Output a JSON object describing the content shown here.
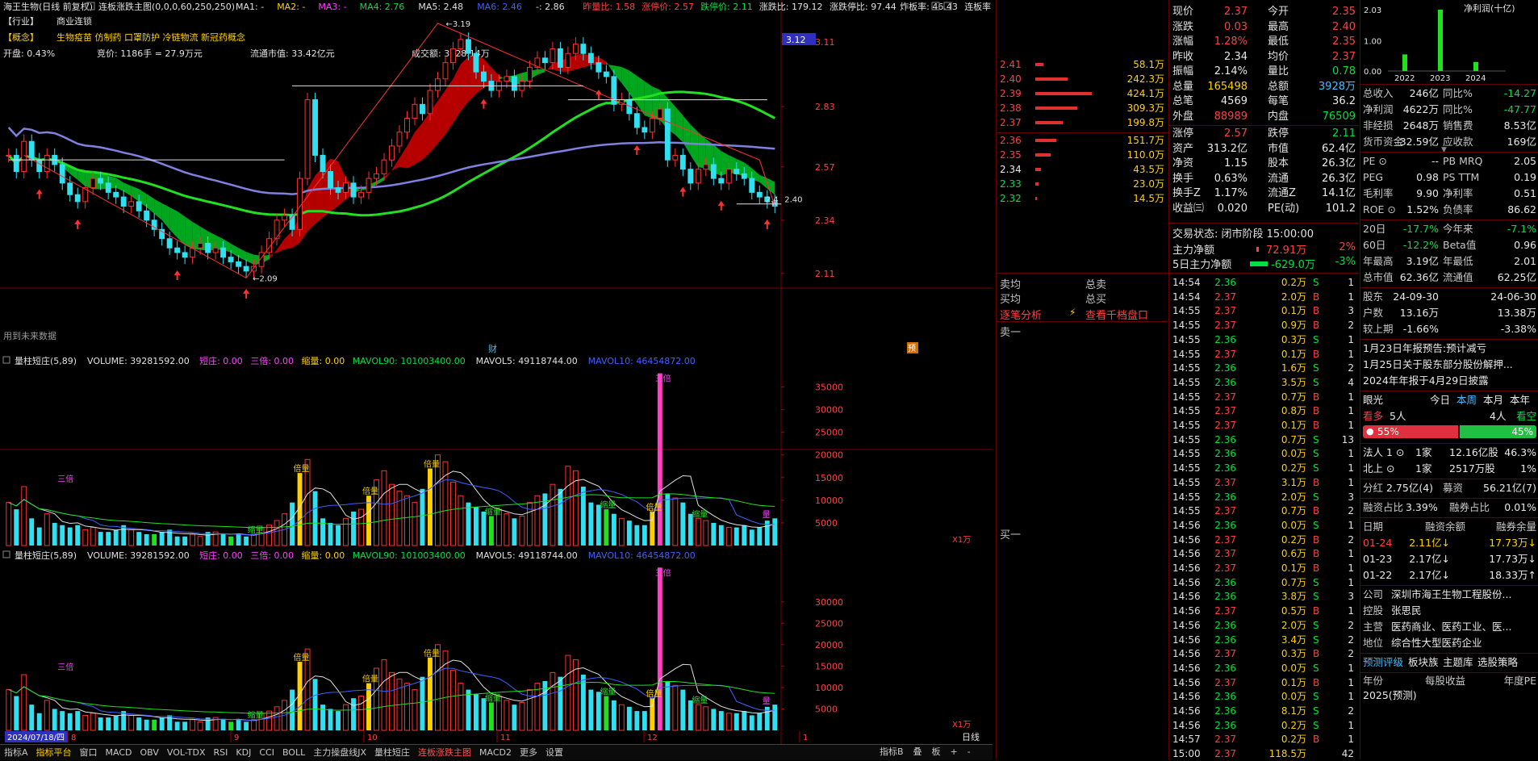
{
  "chart": {
    "title": "海王生物(日线 前复权)",
    "indicator_main": "连板涨跌主图(0,0,0,60,250,250)",
    "ma_labels": [
      {
        "text": "MA1: -",
        "color": "#e0e0e0"
      },
      {
        "text": "MA2: -",
        "color": "#ffd000"
      },
      {
        "text": "MA3: -",
        "color": "#ff40ff"
      },
      {
        "text": "MA4: 2.76",
        "color": "#00e040"
      },
      {
        "text": "MA5: 2.48",
        "color": "#e0e0e0"
      },
      {
        "text": "MA6: 2.46",
        "color": "#4060ff"
      },
      {
        "text": "-: 2.86",
        "color": "#e0e0e0"
      },
      {
        "text": "昨量比: 1.58",
        "color": "#ff4040"
      },
      {
        "text": "涨停价: 2.57",
        "color": "#ff4040"
      },
      {
        "text": "跌停价: 2.11",
        "color": "#00e040"
      },
      {
        "text": "涨跌比: 179.12",
        "color": "#e0e0e0"
      },
      {
        "text": "涨跌停比: 97.44",
        "color": "#e0e0e0"
      },
      {
        "text": "炸板率: 46.43",
        "color": "#e0e0e0"
      },
      {
        "text": "连板率",
        "color": "#e0e0e0"
      }
    ],
    "industry_label": "【行业】",
    "industry_value": "商业连锁",
    "concept_label": "【概念】",
    "concept_value": "生物疫苗 仿制药 口罩防护 冷链物流 新冠药概念",
    "open_pct": "开盘: 0.43%",
    "auction": "竞价: 1186手 = 27.9万元",
    "float_cap": "流通市值: 33.42亿元",
    "turnover_amt": "成交额: 3928.14万",
    "future_data_note": "用到未来数据",
    "price_axis": [
      "3.11",
      "2.83",
      "2.57",
      "2.34",
      "2.11"
    ],
    "current_price_tag": "3.12",
    "high_label": "3.19",
    "low_label": "2.09",
    "last_label": "2.4",
    "last_label_right": "2.40",
    "fin_marker": "财",
    "pre_marker": "预",
    "vol_title": "量柱短庄(5,89)",
    "vol_items": [
      {
        "text": "VOLUME: 39281592.00",
        "color": "#e0e0e0"
      },
      {
        "text": "短庄: 0.00",
        "color": "#ff40ff"
      },
      {
        "text": "三倍: 0.00",
        "color": "#ff40ff"
      },
      {
        "text": "缩量: 0.00",
        "color": "#ffd000"
      },
      {
        "text": "MAVOL90: 101003400.00",
        "color": "#00e040"
      },
      {
        "text": "MAVOL5: 49118744.00",
        "color": "#e0e0e0"
      },
      {
        "text": "MAVOL10: 46454872.00",
        "color": "#4060ff"
      }
    ],
    "vol_axis_1": [
      "35000",
      "30000",
      "25000",
      "20000",
      "15000",
      "10000",
      "5000"
    ],
    "vol_axis_2": [
      "30000",
      "25000",
      "20000",
      "15000",
      "10000",
      "5000"
    ],
    "vol_unit": "X1万",
    "vol_tag_beiliang": "倍量",
    "vol_tag_suoliang": "缩量",
    "vol_tag_sanbei": "三倍",
    "vol_tag_duanzhuang": "三倍",
    "date_label": "2024/07/18/四",
    "month_labels": [
      "8",
      "9",
      "10",
      "11",
      "12",
      "1"
    ],
    "period": "日线"
  },
  "chart_data": {
    "type": "candlestick",
    "ylim": [
      2.05,
      3.2
    ],
    "closes": [
      2.62,
      2.55,
      2.68,
      2.6,
      2.55,
      2.62,
      2.58,
      2.5,
      2.45,
      2.42,
      2.48,
      2.52,
      2.5,
      2.46,
      2.44,
      2.4,
      2.42,
      2.38,
      2.34,
      2.3,
      2.26,
      2.22,
      2.2,
      2.18,
      2.22,
      2.24,
      2.2,
      2.22,
      2.18,
      2.16,
      2.14,
      2.12,
      2.14,
      2.2,
      2.26,
      2.34,
      2.36,
      2.3,
      2.52,
      2.86,
      2.62,
      2.55,
      2.48,
      2.46,
      2.5,
      2.44,
      2.46,
      2.52,
      2.54,
      2.6,
      2.66,
      2.72,
      2.78,
      2.84,
      2.8,
      2.9,
      2.95,
      3.02,
      3.08,
      3.12,
      3.06,
      2.98,
      2.94,
      2.9,
      2.94,
      2.96,
      2.9,
      2.94,
      3.0,
      3.04,
      3.02,
      3.08,
      3.0,
      3.06,
      3.1,
      3.06,
      3.02,
      2.98,
      2.96,
      2.84,
      2.86,
      2.8,
      2.74,
      2.72,
      2.78,
      2.82,
      2.6,
      2.62,
      2.56,
      2.5,
      2.56,
      2.58,
      2.52,
      2.5,
      2.56,
      2.54,
      2.52,
      2.46,
      2.44,
      2.42,
      2.4
    ],
    "volumes": [
      95,
      80,
      130,
      60,
      40,
      70,
      50,
      45,
      40,
      45,
      35,
      40,
      30,
      30,
      35,
      45,
      35,
      30,
      25,
      25,
      30,
      35,
      20,
      20,
      25,
      20,
      30,
      30,
      25,
      20,
      25,
      20,
      25,
      40,
      45,
      55,
      70,
      95,
      160,
      190,
      120,
      60,
      50,
      45,
      60,
      75,
      80,
      110,
      145,
      165,
      135,
      120,
      110,
      95,
      125,
      170,
      200,
      185,
      140,
      110,
      95,
      85,
      75,
      65,
      80,
      70,
      60,
      65,
      95,
      110,
      115,
      135,
      125,
      175,
      165,
      130,
      95,
      90,
      80,
      70,
      60,
      55,
      45,
      45,
      75,
      380,
      115,
      105,
      95,
      70,
      60,
      55,
      50,
      45,
      40,
      40,
      45,
      35,
      40,
      55,
      60
    ],
    "volume_unit": "万手"
  },
  "order_book": {
    "asks": [
      {
        "price": "2.41",
        "vol": "58.1万",
        "bar": 10
      },
      {
        "price": "2.40",
        "vol": "242.3万",
        "bar": 40
      },
      {
        "price": "2.39",
        "vol": "424.1万",
        "bar": 70
      },
      {
        "price": "2.38",
        "vol": "309.3万",
        "bar": 52
      },
      {
        "price": "2.37",
        "vol": "199.8万",
        "bar": 34
      }
    ],
    "bids": [
      {
        "price": "2.36",
        "vol": "151.7万",
        "bar": 26
      },
      {
        "price": "2.35",
        "vol": "110.0万",
        "bar": 19
      },
      {
        "price": "2.34",
        "vol": "43.5万",
        "bar": 7
      },
      {
        "price": "2.33",
        "vol": "23.0万",
        "bar": 4
      },
      {
        "price": "2.32",
        "vol": "14.5万",
        "bar": 2
      }
    ],
    "sell_avg": "卖均",
    "buy_avg": "买均",
    "total_sell": "总卖",
    "total_buy": "总买",
    "tick_analysis": "逐笔分析",
    "view_depth": "查看千档盘口",
    "sell_one": "卖一",
    "buy_one": "买一"
  },
  "quote": {
    "rows": [
      {
        "l1": "现价",
        "v1": "2.37",
        "c1": "red",
        "l2": "今开",
        "v2": "2.35",
        "c2": "red"
      },
      {
        "l1": "涨跌",
        "v1": "0.03",
        "c1": "red",
        "l2": "最高",
        "v2": "2.40",
        "c2": "red"
      },
      {
        "l1": "涨幅",
        "v1": "1.28%",
        "c1": "red",
        "l2": "最低",
        "v2": "2.35",
        "c2": "red"
      },
      {
        "l1": "昨收",
        "v1": "2.34",
        "c1": "white",
        "l2": "均价",
        "v2": "2.37",
        "c2": "red"
      },
      {
        "l1": "振幅",
        "v1": "2.14%",
        "c1": "white",
        "l2": "量比",
        "v2": "0.78",
        "c2": "green"
      },
      {
        "l1": "总量",
        "v1": "165498",
        "c1": "yellow",
        "l2": "总额",
        "v2": "3928万",
        "c2": "cyan"
      },
      {
        "l1": "总笔",
        "v1": "4569",
        "c1": "white",
        "l2": "每笔",
        "v2": "36.2",
        "c2": "white"
      },
      {
        "l1": "外盘",
        "v1": "88989",
        "c1": "red",
        "l2": "内盘",
        "v2": "76509",
        "c2": "green"
      },
      {
        "l1": "涨停",
        "v1": "2.57",
        "c1": "red",
        "l2": "跌停",
        "v2": "2.11",
        "c2": "green"
      },
      {
        "l1": "资产",
        "v1": "313.2亿",
        "c1": "white",
        "l2": "市值",
        "v2": "62.4亿",
        "c2": "white"
      },
      {
        "l1": "净资",
        "v1": "1.15",
        "c1": "white",
        "l2": "股本",
        "v2": "26.3亿",
        "c2": "white"
      },
      {
        "l1": "换手",
        "v1": "0.63%",
        "c1": "white",
        "l2": "流通",
        "v2": "26.3亿",
        "c2": "white"
      },
      {
        "l1": "换手Z",
        "v1": "1.17%",
        "c1": "white",
        "l2": "流通Z",
        "v2": "14.1亿",
        "c2": "white"
      },
      {
        "l1": "收益㈢",
        "v1": "0.020",
        "c1": "white",
        "l2": "PE(动)",
        "v2": "101.2",
        "c2": "white"
      }
    ],
    "trade_status": "交易状态: 闭市阶段 15:00:00",
    "main_net_label": "主力净额",
    "main_net_val": "72.91万",
    "main_net_pct": "2%",
    "five_day_label": "5日主力净额",
    "five_day_val": "-629.0万",
    "five_day_pct": "-3%",
    "ticks": [
      [
        "14:54",
        "2.36",
        "0.2万",
        "S",
        "1"
      ],
      [
        "14:54",
        "2.37",
        "2.0万",
        "B",
        "1"
      ],
      [
        "14:55",
        "2.37",
        "0.1万",
        "B",
        "3"
      ],
      [
        "14:55",
        "2.37",
        "0.9万",
        "B",
        "2"
      ],
      [
        "14:55",
        "2.36",
        "0.3万",
        "S",
        "1"
      ],
      [
        "14:55",
        "2.37",
        "0.1万",
        "B",
        "1"
      ],
      [
        "14:55",
        "2.36",
        "1.6万",
        "S",
        "2"
      ],
      [
        "14:55",
        "2.36",
        "3.5万",
        "S",
        "4"
      ],
      [
        "14:55",
        "2.37",
        "0.7万",
        "B",
        "1"
      ],
      [
        "14:55",
        "2.37",
        "0.8万",
        "B",
        "1"
      ],
      [
        "14:55",
        "2.37",
        "0.1万",
        "B",
        "1"
      ],
      [
        "14:55",
        "2.36",
        "0.7万",
        "S",
        "13"
      ],
      [
        "14:55",
        "2.36",
        "0.0万",
        "S",
        "1"
      ],
      [
        "14:55",
        "2.36",
        "0.2万",
        "S",
        "1"
      ],
      [
        "14:55",
        "2.37",
        "3.1万",
        "B",
        "1"
      ],
      [
        "14:55",
        "2.36",
        "2.0万",
        "S",
        "3"
      ],
      [
        "14:55",
        "2.37",
        "0.7万",
        "B",
        "2"
      ],
      [
        "14:56",
        "2.36",
        "0.0万",
        "S",
        "1"
      ],
      [
        "14:56",
        "2.37",
        "0.2万",
        "B",
        "2"
      ],
      [
        "14:56",
        "2.37",
        "0.6万",
        "B",
        "1"
      ],
      [
        "14:56",
        "2.37",
        "0.1万",
        "B",
        "1"
      ],
      [
        "14:56",
        "2.36",
        "0.7万",
        "S",
        "1"
      ],
      [
        "14:56",
        "2.36",
        "3.8万",
        "S",
        "3"
      ],
      [
        "14:56",
        "2.37",
        "0.5万",
        "B",
        "1"
      ],
      [
        "14:56",
        "2.36",
        "2.0万",
        "S",
        "2"
      ],
      [
        "14:56",
        "2.36",
        "3.4万",
        "S",
        "2"
      ],
      [
        "14:56",
        "2.37",
        "0.3万",
        "B",
        "2"
      ],
      [
        "14:56",
        "2.36",
        "0.0万",
        "S",
        "1"
      ],
      [
        "14:56",
        "2.37",
        "0.1万",
        "B",
        "1"
      ],
      [
        "14:56",
        "2.36",
        "0.0万",
        "S",
        "1"
      ],
      [
        "14:56",
        "2.36",
        "8.1万",
        "S",
        "2"
      ],
      [
        "14:56",
        "2.36",
        "0.2万",
        "S",
        "1"
      ],
      [
        "14:57",
        "2.37",
        "0.2万",
        "B",
        "1"
      ],
      [
        "15:00",
        "2.37",
        "118.5万",
        "",
        "42"
      ]
    ]
  },
  "f10": {
    "profit_axis": [
      "2.03",
      "1.00",
      "0.00"
    ],
    "profit_title": "净利润(十亿)",
    "profit_years": [
      "2022",
      "2023",
      "2024"
    ],
    "profit_values": [
      0.55,
      2.03,
      0.3
    ],
    "rows": [
      {
        "l1": "总收入",
        "v1": "246亿",
        "l2": "同比%",
        "v2": "-14.27",
        "c2": "green"
      },
      {
        "l1": "净利润",
        "v1": "4622万",
        "l2": "同比%",
        "v2": "-47.77",
        "c2": "green"
      },
      {
        "l1": "非经损",
        "v1": "2648万",
        "l2": "销售费",
        "v2": "8.53亿",
        "c2": "white"
      },
      {
        "l1": "货币资金",
        "v1": "32.59亿",
        "l2": "应收款",
        "v2": "169亿",
        "c2": "white"
      }
    ],
    "rows2": [
      {
        "l1": "PE ⊙",
        "v1": "--",
        "l2": "PB MRQ",
        "v2": "2.05"
      },
      {
        "l1": "PEG",
        "v1": "0.98",
        "l2": "PS TTM",
        "v2": "0.19"
      },
      {
        "l1": "毛利率",
        "v1": "9.90",
        "l2": "净利率",
        "v2": "0.51"
      },
      {
        "l1": "ROE ⊙",
        "v1": "1.52%",
        "l2": "负债率",
        "v2": "86.62"
      }
    ],
    "rows3": [
      {
        "l1": "20日",
        "v1": "-17.7%",
        "c1": "green",
        "l2": "今年来",
        "v2": "-7.1%",
        "c2": "green"
      },
      {
        "l1": "60日",
        "v1": "-12.2%",
        "c1": "green",
        "l2": "Beta值",
        "v2": "0.96",
        "c2": "white"
      },
      {
        "l1": "年最高",
        "v1": "3.19亿",
        "c1": "white",
        "l2": "年最低",
        "v2": "2.01",
        "c2": "white"
      },
      {
        "l1": "总市值",
        "v1": "62.36亿",
        "c1": "white",
        "l2": "流通值",
        "v2": "62.25亿",
        "c2": "white"
      }
    ],
    "holders_label": "股东",
    "holders_d1": "24-09-30",
    "holders_d2": "24-06-30",
    "households_label": "户数",
    "households_v1": "13.16万",
    "households_v2": "13.38万",
    "vs_prev_label": "较上期",
    "vs_prev_v1": "-1.66%",
    "vs_prev_v2": "-3.38%",
    "news": [
      "1月23日年报预告:预计减亏",
      "1月25日关于股东部分股份解押...",
      "2024年年报于4月29日披露"
    ],
    "eye_label": "眼光",
    "eye_tabs": [
      "今日",
      "本周",
      "本月",
      "本年"
    ],
    "bull_label": "看多",
    "bull_count": "5人",
    "bear_count": "4人",
    "bear_label": "看空",
    "bull_pct": "55%",
    "bear_pct": "45%",
    "fund_rows": [
      {
        "l": "法人 1 ⊙",
        "a": "1家",
        "b": "12.16亿股",
        "c": "46.3%"
      },
      {
        "l": "北上 ⊙",
        "a": "1家",
        "b": "2517万股",
        "c": "1%"
      }
    ],
    "dividend": "分红 2.75亿(4)募资 56.21亿(7)",
    "dividend_label": "分红",
    "dividend_val": "2.75亿(4)",
    "raise_label": "募资",
    "raise_val": "56.21亿(7)",
    "margin_ratio_label": "融资占比",
    "margin_ratio": "3.39%",
    "short_ratio_label": "融券占比",
    "short_ratio": "0.01%",
    "margin_head": [
      "日期",
      "融资余额",
      "融券余量"
    ],
    "margin_rows": [
      {
        "d": "01-24",
        "a": "2.11亿↓",
        "b": "17.73万↓",
        "hl": true
      },
      {
        "d": "01-23",
        "a": "2.17亿↓",
        "b": "17.73万↓",
        "hl": false
      },
      {
        "d": "01-22",
        "a": "2.17亿↓",
        "b": "18.33万↑",
        "hl": false
      }
    ],
    "company_label": "公司",
    "company": "深圳市海王生物工程股份...",
    "control_label": "控股",
    "control": "张思民",
    "business_label": "主营",
    "business": "医药商业、医药工业、医...",
    "position_label": "地位",
    "position": "综合性大型医药企业",
    "tabs": [
      "预测评级",
      "板块族",
      "主题库",
      "选股策略"
    ],
    "year_head": [
      "年份",
      "每股收益",
      "年度PE"
    ],
    "year_row": "2025(预测)"
  },
  "bottom_tabs": [
    {
      "t": "指标A",
      "c": ""
    },
    {
      "t": "指标平台",
      "c": "active"
    },
    {
      "t": "窗口",
      "c": ""
    },
    {
      "t": "MACD",
      "c": ""
    },
    {
      "t": "OBV",
      "c": ""
    },
    {
      "t": "VOL-TDX",
      "c": ""
    },
    {
      "t": "RSI",
      "c": ""
    },
    {
      "t": "KDJ",
      "c": ""
    },
    {
      "t": "CCI",
      "c": ""
    },
    {
      "t": "BOLL",
      "c": ""
    },
    {
      "t": "主力操盘线JX",
      "c": ""
    },
    {
      "t": "量柱短庄",
      "c": ""
    },
    {
      "t": "连板涨跌主图",
      "c": "hl"
    },
    {
      "t": "MACD2",
      "c": ""
    },
    {
      "t": "更多",
      "c": ""
    },
    {
      "t": "设置",
      "c": ""
    }
  ],
  "bottom_right": [
    "指标B",
    "叠",
    "板",
    "+",
    "-"
  ]
}
